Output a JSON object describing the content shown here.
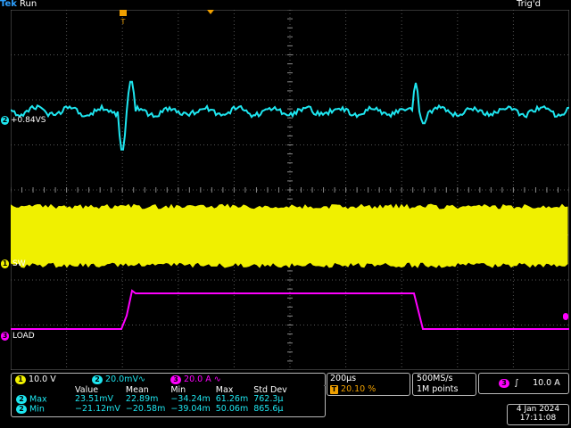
{
  "header": {
    "brand": "Tek",
    "run_state": "Run",
    "trigger_status": "Trig'd"
  },
  "markers": {
    "trigger_position": "T"
  },
  "channels": {
    "ch2": {
      "num": "2",
      "label": "+0.84VS",
      "color": "#1ee6f0"
    },
    "ch1": {
      "num": "1",
      "label": "SW",
      "color": "#f0f000"
    },
    "ch3": {
      "num": "3",
      "label": "LOAD",
      "color": "#ff00ff"
    }
  },
  "scales": {
    "ch1": {
      "num": "1",
      "value": "10.0 V"
    },
    "ch2": {
      "num": "2",
      "value": "20.0mV",
      "coupling": "∿"
    },
    "ch3": {
      "num": "3",
      "value": "20.0 A",
      "coupling": "∿"
    }
  },
  "timebase": {
    "per_div": "200μs",
    "trigger_marker": "T",
    "position": "20.10 %"
  },
  "acquisition": {
    "rate": "500MS/s",
    "points": "1M points"
  },
  "trigger": {
    "source": "3",
    "slope_icon": "rising-edge",
    "level": "10.0 A"
  },
  "measurements": {
    "headers": [
      "Value",
      "Mean",
      "Min",
      "Max",
      "Std Dev"
    ],
    "rows": [
      {
        "ch": "2",
        "name": "Max",
        "value": "23.51mV",
        "mean": "22.89m",
        "min": "−34.24m",
        "max": "61.26m",
        "std": "762.3μ"
      },
      {
        "ch": "2",
        "name": "Min",
        "value": "−21.12mV",
        "mean": "−20.58m",
        "min": "−39.04m",
        "max": "50.06m",
        "std": "865.6μ"
      }
    ]
  },
  "datetime": {
    "date": "4 Jan  2024",
    "time": "17:11:08"
  }
}
